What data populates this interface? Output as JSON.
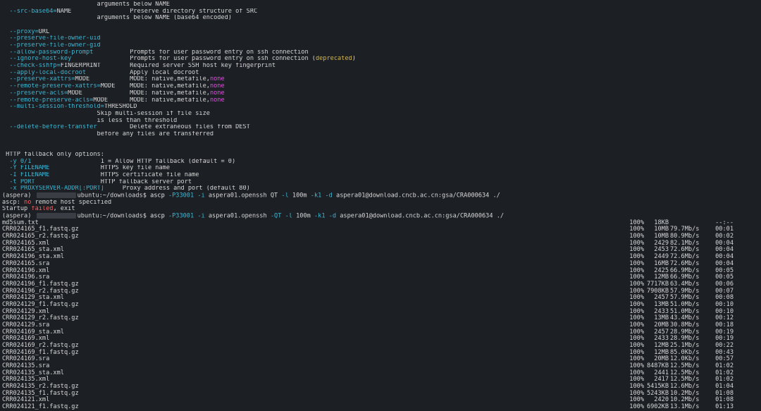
{
  "help_lines": [
    {
      "segs": [
        {
          "t": "                          arguments below NAME",
          "c": ""
        }
      ]
    },
    {
      "segs": [
        {
          "t": "  --src-base64=",
          "c": "opt"
        },
        {
          "t": "NAME",
          "c": ""
        },
        {
          "t": "                Preserve directory structure of SRC",
          "c": ""
        }
      ]
    },
    {
      "segs": [
        {
          "t": "                          arguments below NAME (base64 encoded)",
          "c": ""
        }
      ]
    },
    {
      "segs": [
        {
          "t": "",
          "c": ""
        }
      ]
    },
    {
      "segs": [
        {
          "t": "  --proxy=",
          "c": "opt"
        },
        {
          "t": "URL",
          "c": ""
        }
      ]
    },
    {
      "segs": [
        {
          "t": "  --preserve-file-owner-uid",
          "c": "opt"
        }
      ]
    },
    {
      "segs": [
        {
          "t": "  --preserve-file-owner-gid",
          "c": "opt"
        }
      ]
    },
    {
      "segs": [
        {
          "t": "  --allow-password-prompt",
          "c": "opt"
        },
        {
          "t": "          Prompts for user password entry on ssh connection",
          "c": ""
        }
      ]
    },
    {
      "segs": [
        {
          "t": "  --ignore-host-key",
          "c": "opt"
        },
        {
          "t": "                Prompts for user password entry on ssh connection (",
          "c": ""
        },
        {
          "t": "deprecated",
          "c": "yel"
        },
        {
          "t": ")",
          "c": ""
        }
      ]
    },
    {
      "segs": [
        {
          "t": "  --check-sshfp=",
          "c": "opt"
        },
        {
          "t": "FINGERPRINT",
          "c": ""
        },
        {
          "t": "        Required server SSH host key fingerprint",
          "c": ""
        }
      ]
    },
    {
      "segs": [
        {
          "t": "  --apply-local-docroot",
          "c": "opt"
        },
        {
          "t": "            Apply local docroot",
          "c": ""
        }
      ]
    },
    {
      "segs": [
        {
          "t": "  --preserve-xattrs=",
          "c": "opt"
        },
        {
          "t": "MODE",
          "c": ""
        },
        {
          "t": "           MODE: native,metafile,",
          "c": ""
        },
        {
          "t": "none",
          "c": "mag"
        }
      ]
    },
    {
      "segs": [
        {
          "t": "  --remote-preserve-xattrs=",
          "c": "opt"
        },
        {
          "t": "MODE",
          "c": ""
        },
        {
          "t": "    MODE: native,metafile,",
          "c": ""
        },
        {
          "t": "none",
          "c": "mag"
        }
      ]
    },
    {
      "segs": [
        {
          "t": "  --preserve-acls=",
          "c": "opt"
        },
        {
          "t": "MODE",
          "c": ""
        },
        {
          "t": "             MODE: native,metafile,",
          "c": ""
        },
        {
          "t": "none",
          "c": "mag"
        }
      ]
    },
    {
      "segs": [
        {
          "t": "  --remote-preserve-acls=",
          "c": "opt"
        },
        {
          "t": "MODE",
          "c": ""
        },
        {
          "t": "      MODE: native,metafile,",
          "c": ""
        },
        {
          "t": "none",
          "c": "mag"
        }
      ]
    },
    {
      "segs": [
        {
          "t": "  --multi-session-threshold=",
          "c": "opt"
        },
        {
          "t": "THRESHOLD",
          "c": ""
        }
      ]
    },
    {
      "segs": [
        {
          "t": "                          Skip multi-session if file size",
          "c": ""
        }
      ]
    },
    {
      "segs": [
        {
          "t": "                          is less than threshold",
          "c": ""
        }
      ]
    },
    {
      "segs": [
        {
          "t": "  --delete-before-transfer",
          "c": "opt"
        },
        {
          "t": "         Delete extraneous files from DEST",
          "c": ""
        }
      ]
    },
    {
      "segs": [
        {
          "t": "                          before any files are transferred",
          "c": ""
        }
      ]
    },
    {
      "segs": [
        {
          "t": "",
          "c": ""
        }
      ]
    },
    {
      "segs": [
        {
          "t": "",
          "c": ""
        }
      ]
    },
    {
      "segs": [
        {
          "t": " HTTP fallback only options:",
          "c": ""
        }
      ]
    },
    {
      "segs": [
        {
          "t": "  -y 0/1",
          "c": "opt"
        },
        {
          "t": "                   1 = Allow HTTP fallback (default = 0)",
          "c": ""
        }
      ]
    },
    {
      "segs": [
        {
          "t": "  -Y FILENAME",
          "c": "opt"
        },
        {
          "t": "              HTTPS key file name",
          "c": ""
        }
      ]
    },
    {
      "segs": [
        {
          "t": "  -I FILENAME",
          "c": "opt"
        },
        {
          "t": "              HTTPS certificate file name",
          "c": ""
        }
      ]
    },
    {
      "segs": [
        {
          "t": "  -t PORT",
          "c": "opt"
        },
        {
          "t": "                  HTTP fallback server port",
          "c": ""
        }
      ]
    },
    {
      "segs": [
        {
          "t": "  -x PROXYSERVER-ADDR[:PORT]",
          "c": "opt"
        },
        {
          "t": "     Proxy address and port (default 80)",
          "c": ""
        }
      ]
    }
  ],
  "cmd1": {
    "prompt_start": "(aspera) ",
    "prompt_rest": "ubuntu:~/downloads$ ",
    "segs": [
      {
        "t": "ascp ",
        "c": "prm"
      },
      {
        "t": "-P33001",
        "c": "opt"
      },
      {
        "t": " ",
        "c": ""
      },
      {
        "t": "-i",
        "c": "opt"
      },
      {
        "t": " aspera01.openssh QT ",
        "c": ""
      },
      {
        "t": "-l",
        "c": "opt"
      },
      {
        "t": " 100m ",
        "c": ""
      },
      {
        "t": "-k1",
        "c": "opt"
      },
      {
        "t": " ",
        "c": ""
      },
      {
        "t": "-d",
        "c": "opt"
      },
      {
        "t": " aspera01@download.cncb.ac.cn:gsa/CRA000634 ./",
        "c": ""
      }
    ]
  },
  "error_lines": [
    {
      "segs": [
        {
          "t": "ascp: ",
          "c": ""
        },
        {
          "t": "no",
          "c": "red"
        },
        {
          "t": " remote host specified",
          "c": ""
        }
      ]
    },
    {
      "segs": [
        {
          "t": "Startup ",
          "c": ""
        },
        {
          "t": "failed",
          "c": "red"
        },
        {
          "t": ", exit",
          "c": ""
        }
      ]
    }
  ],
  "cmd2": {
    "prompt_start": "(aspera) ",
    "prompt_rest": "ubuntu:~/downloads$ ",
    "segs": [
      {
        "t": "ascp ",
        "c": "prm"
      },
      {
        "t": "-P33001",
        "c": "opt"
      },
      {
        "t": " ",
        "c": ""
      },
      {
        "t": "-i",
        "c": "opt"
      },
      {
        "t": " aspera01.openssh ",
        "c": ""
      },
      {
        "t": "-QT",
        "c": "opt"
      },
      {
        "t": " ",
        "c": ""
      },
      {
        "t": "-l",
        "c": "opt"
      },
      {
        "t": " 100m ",
        "c": ""
      },
      {
        "t": "-k1",
        "c": "opt"
      },
      {
        "t": " ",
        "c": ""
      },
      {
        "t": "-d",
        "c": "opt"
      },
      {
        "t": " aspera01@download.cncb.ac.cn:gsa/CRA000634 ./",
        "c": ""
      }
    ]
  },
  "transfers": [
    {
      "name": "md5sum.txt",
      "pct": "100%",
      "size": "18KB",
      "rate": "",
      "time": "--:--"
    },
    {
      "name": "CRR024165_f1.fastq.gz",
      "pct": "100%",
      "size": "10MB",
      "rate": "79.7Mb/s",
      "time": "00:01"
    },
    {
      "name": "CRR024165_r2.fastq.gz",
      "pct": "100%",
      "size": "10MB",
      "rate": "80.9Mb/s",
      "time": "00:02"
    },
    {
      "name": "CRR024165.xml",
      "pct": "100%",
      "size": "2429",
      "rate": "82.1Mb/s",
      "time": "00:04"
    },
    {
      "name": "CRR024165_sta.xml",
      "pct": "100%",
      "size": "2453",
      "rate": "72.6Mb/s",
      "time": "00:04"
    },
    {
      "name": "CRR024196_sta.xml",
      "pct": "100%",
      "size": "2449",
      "rate": "72.6Mb/s",
      "time": "00:04"
    },
    {
      "name": "CRR024165.sra",
      "pct": "100%",
      "size": "16MB",
      "rate": "72.6Mb/s",
      "time": "00:04"
    },
    {
      "name": "CRR024196.xml",
      "pct": "100%",
      "size": "2425",
      "rate": "66.9Mb/s",
      "time": "00:05"
    },
    {
      "name": "CRR024196.sra",
      "pct": "100%",
      "size": "12MB",
      "rate": "66.9Mb/s",
      "time": "00:05"
    },
    {
      "name": "CRR024196_f1.fastq.gz",
      "pct": "100%",
      "size": "7717KB",
      "rate": "63.4Mb/s",
      "time": "00:06"
    },
    {
      "name": "CRR024196_r2.fastq.gz",
      "pct": "100%",
      "size": "7908KB",
      "rate": "57.9Mb/s",
      "time": "00:07"
    },
    {
      "name": "CRR024129_sta.xml",
      "pct": "100%",
      "size": "2457",
      "rate": "57.9Mb/s",
      "time": "00:08"
    },
    {
      "name": "CRR024129_f1.fastq.gz",
      "pct": "100%",
      "size": "13MB",
      "rate": "51.0Mb/s",
      "time": "00:10"
    },
    {
      "name": "CRR024129.xml",
      "pct": "100%",
      "size": "2433",
      "rate": "51.0Mb/s",
      "time": "00:10"
    },
    {
      "name": "CRR024129_r2.fastq.gz",
      "pct": "100%",
      "size": "13MB",
      "rate": "43.4Mb/s",
      "time": "00:12"
    },
    {
      "name": "CRR024129.sra",
      "pct": "100%",
      "size": "20MB",
      "rate": "30.8Mb/s",
      "time": "00:18"
    },
    {
      "name": "CRR024169_sta.xml",
      "pct": "100%",
      "size": "2457",
      "rate": "28.9Mb/s",
      "time": "00:19"
    },
    {
      "name": "CRR024169.xml",
      "pct": "100%",
      "size": "2433",
      "rate": "28.9Mb/s",
      "time": "00:19"
    },
    {
      "name": "CRR024169_r2.fastq.gz",
      "pct": "100%",
      "size": "12MB",
      "rate": "25.1Mb/s",
      "time": "00:22"
    },
    {
      "name": "CRR024169_f1.fastq.gz",
      "pct": "100%",
      "size": "12MB",
      "rate": "85.0Kb/s",
      "time": "00:43"
    },
    {
      "name": "CRR024169.sra",
      "pct": "100%",
      "size": "20MB",
      "rate": "12.0Kb/s",
      "time": "00:57"
    },
    {
      "name": "CRR024135.sra",
      "pct": "100%",
      "size": "8487KB",
      "rate": "12.5Mb/s",
      "time": "01:02"
    },
    {
      "name": "CRR024135_sta.xml",
      "pct": "100%",
      "size": "2441",
      "rate": "12.5Mb/s",
      "time": "01:02"
    },
    {
      "name": "CRR024135.xml",
      "pct": "100%",
      "size": "2417",
      "rate": "12.5Mb/s",
      "time": "01:02"
    },
    {
      "name": "CRR024135_r2.fastq.gz",
      "pct": "100%",
      "size": "5415KB",
      "rate": "12.6Mb/s",
      "time": "01:04"
    },
    {
      "name": "CRR024135_f1.fastq.gz",
      "pct": "100%",
      "size": "5243KB",
      "rate": "10.2Mb/s",
      "time": "01:08"
    },
    {
      "name": "CRR024121.xml",
      "pct": "100%",
      "size": "2420",
      "rate": "10.2Mb/s",
      "time": "01:08"
    },
    {
      "name": "CRR024121_f1.fastq.gz",
      "pct": "100%",
      "size": "6902KB",
      "rate": "13.1Mb/s",
      "time": "01:13"
    }
  ],
  "colors": {
    "background": "#1c1f24",
    "text": "#d7d7d7",
    "option": "#3fb7d3",
    "none_value": "#e052e0",
    "deprecated": "#d6b84a",
    "error": "#ff5f5f"
  }
}
